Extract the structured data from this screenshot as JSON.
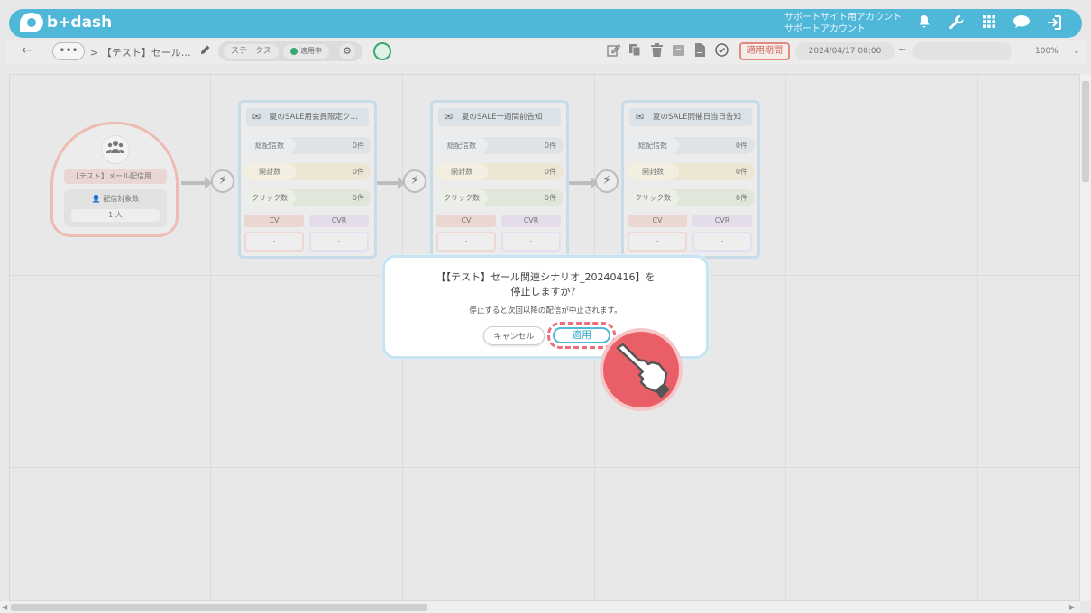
{
  "header": {
    "logo_text": "b+dash",
    "account_line1": "サポートサイト用アカウント",
    "account_line2": "サポートアカウント",
    "icons": [
      "bell-icon",
      "wrench-icon",
      "grid-icon",
      "chat-icon",
      "logout-icon"
    ]
  },
  "toolbar": {
    "back": "←",
    "more": "•••",
    "breadcrumb": "> 【テスト】セール…",
    "status_label": "ステータス",
    "active_label": "適用中",
    "period_button": "適用期間",
    "start_date": "2024/04/17 00:00",
    "tilde": "~",
    "end_date": "",
    "zoom": "100%",
    "tool_icons": [
      "edit-icon",
      "copy-icon",
      "trash-icon",
      "archive-icon",
      "document-icon",
      "check-circle-icon"
    ]
  },
  "start_node": {
    "label": "【テスト】メール配信用…",
    "target_label": "配信対象数",
    "target_value": "1 人"
  },
  "mail_nodes": [
    {
      "title": "夏のSALE用会員限定ク…",
      "stats": [
        {
          "label": "総配信数",
          "value": "0件"
        },
        {
          "label": "開封数",
          "value": "0件"
        },
        {
          "label": "クリック数",
          "value": "0件"
        }
      ],
      "cv_label": "CV",
      "cvr_label": "CVR",
      "cv_value": "-",
      "cvr_value": "-"
    },
    {
      "title": "夏のSALE一週間前告知",
      "stats": [
        {
          "label": "総配信数",
          "value": "0件"
        },
        {
          "label": "開封数",
          "value": "0件"
        },
        {
          "label": "クリック数",
          "value": "0件"
        }
      ],
      "cv_label": "CV",
      "cvr_label": "CVR",
      "cv_value": "-",
      "cvr_value": "-"
    },
    {
      "title": "夏のSALE開催日当日告知",
      "stats": [
        {
          "label": "総配信数",
          "value": "0件"
        },
        {
          "label": "開封数",
          "value": "0件"
        },
        {
          "label": "クリック数",
          "value": "0件"
        }
      ],
      "cv_label": "CV",
      "cvr_label": "CVR",
      "cv_value": "-",
      "cvr_value": "-"
    }
  ],
  "dialog": {
    "title_line1": "【【テスト】セール関連シナリオ_20240416】を",
    "title_line2": "停止しますか？",
    "message": "停止すると次回以降の配信が中止されます。",
    "cancel_label": "キャンセル",
    "apply_label": "適用"
  },
  "colors": {
    "brand": "#4fb8d8",
    "highlight": "#ef6e7e",
    "active_dot": "#3aa870"
  }
}
